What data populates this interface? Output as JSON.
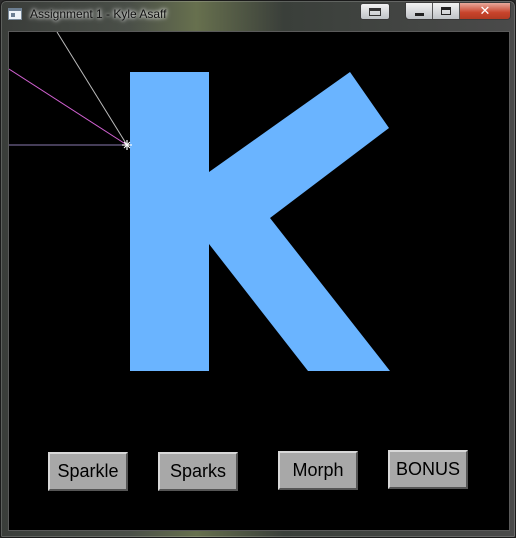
{
  "window": {
    "title": "Assignment 1 - Kyle Asaff",
    "controls": [
      "minimize",
      "maximize",
      "close"
    ],
    "close_glyph": "✕"
  },
  "canvas": {
    "background": "#000000",
    "letter_color": "#6ab4ff",
    "line_colors": [
      "#bbbbbb",
      "#d060d0",
      "#8a7ab0"
    ],
    "sparkle_color": "#ffffff"
  },
  "buttons": {
    "sparkle_label": "Sparkle",
    "sparks_label": "Sparks",
    "morph_label": "Morph",
    "bonus_label": "BONUS"
  }
}
